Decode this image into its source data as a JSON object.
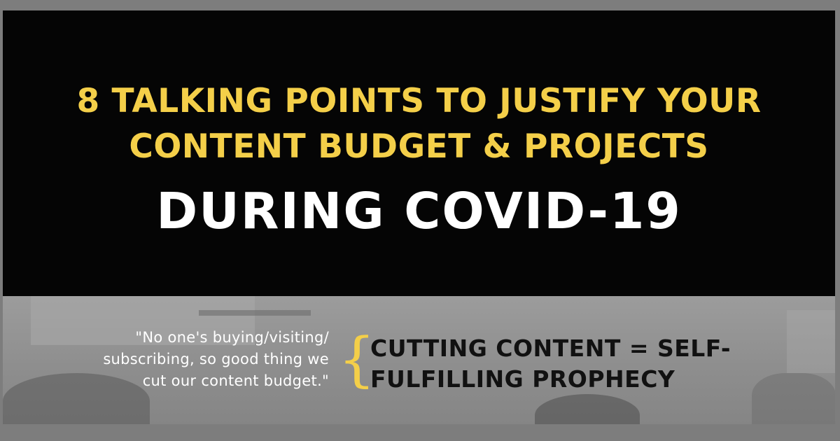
{
  "title": {
    "line1": "8 TALKING POINTS TO JUSTIFY YOUR",
    "line2": "CONTENT BUDGET & PROJECTS",
    "line3": "DURING COVID-19"
  },
  "quote": {
    "line1": "\"No one's buying/visiting/",
    "line2": "subscribing, so good thing we",
    "line3": "cut our content budget.\""
  },
  "brace": "{",
  "tagline": {
    "line1": "CUTTING CONTENT = SELF-",
    "line2": "FULFILLING PROPHECY"
  },
  "colors": {
    "accent_yellow": "#f4cf49",
    "header_background": "#050505",
    "outer_frame": "#7d7d7d",
    "photo_tint": "#919191"
  }
}
